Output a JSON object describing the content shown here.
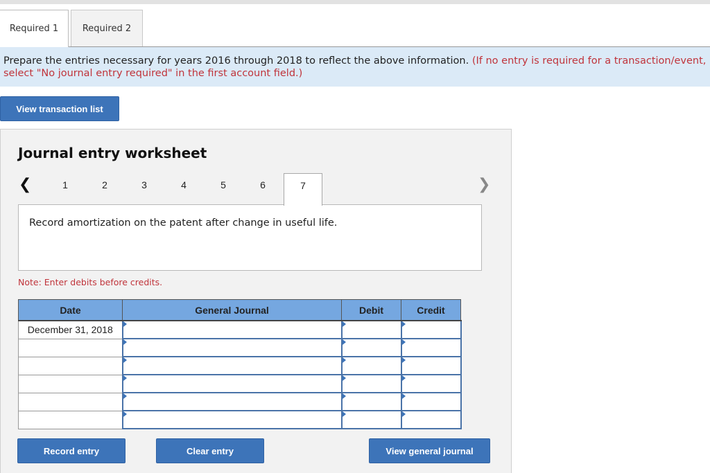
{
  "tabs": [
    {
      "label": "Required 1",
      "active": true
    },
    {
      "label": "Required 2",
      "active": false
    }
  ],
  "instructions": {
    "main": "Prepare the entries necessary for years 2016 through 2018 to reflect the above information.",
    "note": "(If no entry is required for a transaction/event, select \"No journal entry required\" in the first account field.)"
  },
  "view_transaction_list_label": "View transaction list",
  "worksheet": {
    "title": "Journal entry worksheet",
    "steps": [
      "1",
      "2",
      "3",
      "4",
      "5",
      "6",
      "7"
    ],
    "active_step": "7",
    "description": "Record amortization on the patent after change in useful life.",
    "note": "Note: Enter debits before credits.",
    "table": {
      "headers": [
        "Date",
        "General Journal",
        "Debit",
        "Credit"
      ],
      "rows": [
        {
          "date": "December 31, 2018",
          "account": "",
          "debit": "",
          "credit": ""
        },
        {
          "date": "",
          "account": "",
          "debit": "",
          "credit": ""
        },
        {
          "date": "",
          "account": "",
          "debit": "",
          "credit": ""
        },
        {
          "date": "",
          "account": "",
          "debit": "",
          "credit": ""
        },
        {
          "date": "",
          "account": "",
          "debit": "",
          "credit": ""
        },
        {
          "date": "",
          "account": "",
          "debit": "",
          "credit": ""
        }
      ]
    },
    "buttons": {
      "record": "Record entry",
      "clear": "Clear entry",
      "view_journal": "View general journal"
    }
  },
  "colors": {
    "accent": "#3d74b9",
    "header_blue": "#75a7e0",
    "instruction_bg": "#dbeaf7",
    "note_red": "#c0343b"
  }
}
